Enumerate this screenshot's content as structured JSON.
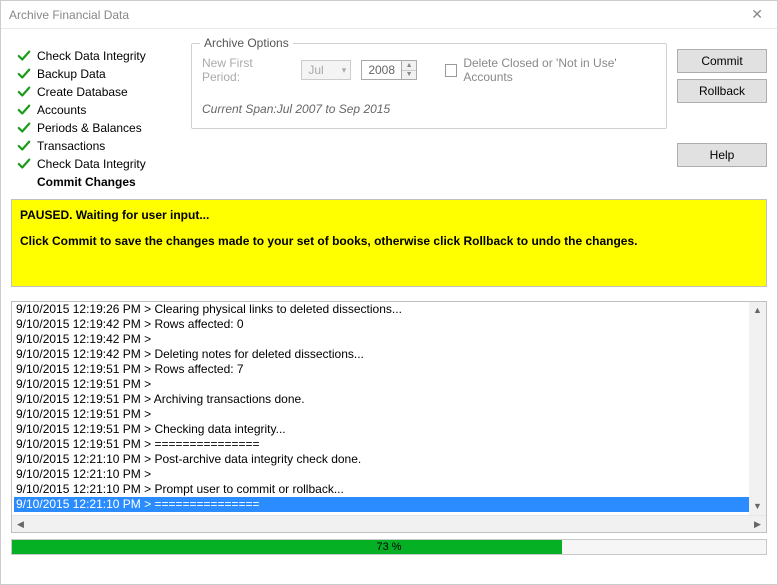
{
  "window": {
    "title": "Archive Financial Data"
  },
  "steps": [
    {
      "label": "Check Data Integrity",
      "done": true
    },
    {
      "label": "Backup Data",
      "done": true
    },
    {
      "label": "Create Database",
      "done": true
    },
    {
      "label": "Accounts",
      "done": true
    },
    {
      "label": "Periods & Balances",
      "done": true
    },
    {
      "label": "Transactions",
      "done": true
    },
    {
      "label": "Check Data Integrity",
      "done": true
    },
    {
      "label": "Commit Changes",
      "done": false,
      "current": true
    }
  ],
  "options": {
    "legend": "Archive Options",
    "period_label": "New First Period:",
    "month": "Jul",
    "year": "2008",
    "delete_label": "Delete Closed or 'Not in Use' Accounts",
    "span_text": "Current Span:Jul 2007 to Sep 2015"
  },
  "buttons": {
    "commit": "Commit",
    "rollback": "Rollback",
    "help": "Help"
  },
  "notice": {
    "line1": "PAUSED. Waiting for user input...",
    "line2": "Click Commit to save the changes made to your set of books, otherwise click Rollback to undo the changes."
  },
  "log": [
    {
      "text": "9/10/2015 12:19:26 PM > Clearing physical links to deleted dissections..."
    },
    {
      "text": "9/10/2015 12:19:42 PM > Rows affected: 0"
    },
    {
      "text": "9/10/2015 12:19:42 PM >"
    },
    {
      "text": "9/10/2015 12:19:42 PM > Deleting notes for deleted dissections..."
    },
    {
      "text": "9/10/2015 12:19:51 PM > Rows affected: 7"
    },
    {
      "text": "9/10/2015 12:19:51 PM >"
    },
    {
      "text": "9/10/2015 12:19:51 PM > Archiving transactions done."
    },
    {
      "text": "9/10/2015 12:19:51 PM >"
    },
    {
      "text": "9/10/2015 12:19:51 PM > Checking data integrity..."
    },
    {
      "text": "9/10/2015 12:19:51 PM > ==============="
    },
    {
      "text": "9/10/2015 12:21:10 PM > Post-archive data integrity check done."
    },
    {
      "text": "9/10/2015 12:21:10 PM >"
    },
    {
      "text": "9/10/2015 12:21:10 PM > Prompt user to commit or rollback..."
    },
    {
      "text": "9/10/2015 12:21:10 PM > ===============",
      "selected": true
    }
  ],
  "progress": {
    "percent": 73,
    "label": "73 %"
  }
}
